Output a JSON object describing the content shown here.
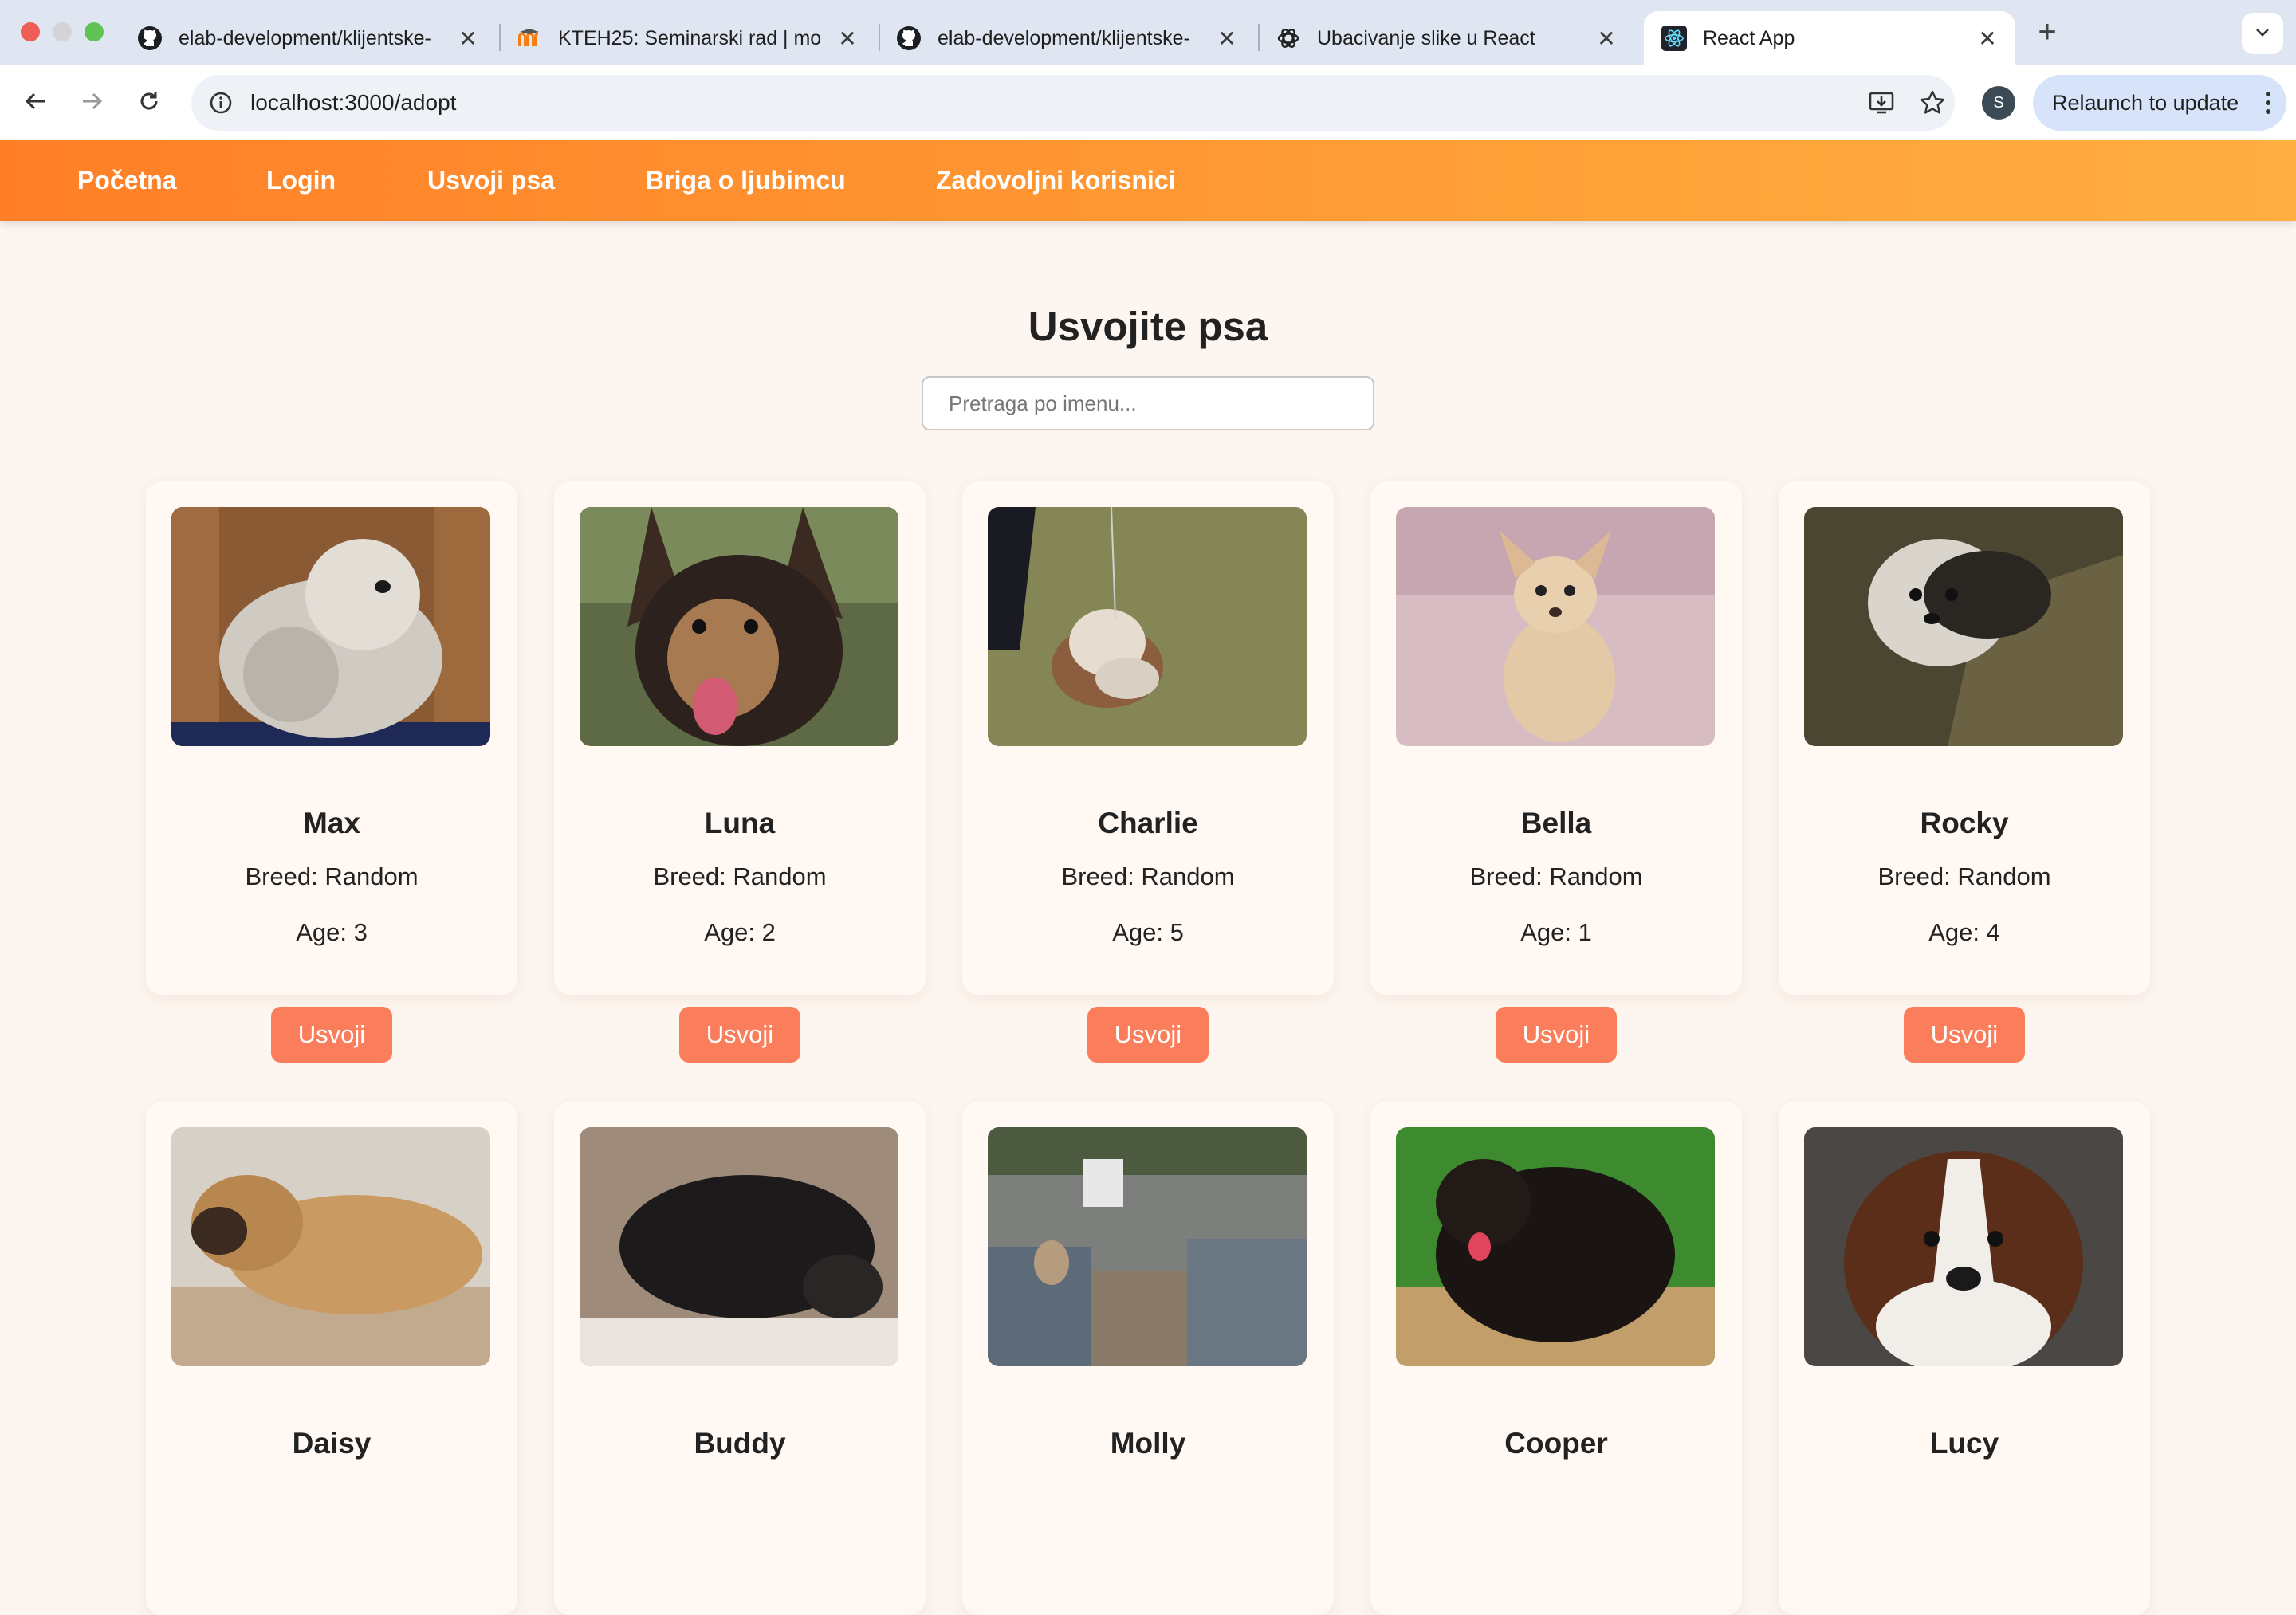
{
  "browser": {
    "tabs": [
      {
        "title": "elab-development/klijentske-",
        "icon": "github-icon",
        "active": false
      },
      {
        "title": "KTEH25: Seminarski rad | mo",
        "icon": "moodle-icon",
        "active": false
      },
      {
        "title": "elab-development/klijentske-",
        "icon": "github-icon",
        "active": false
      },
      {
        "title": "Ubacivanje slike u React",
        "icon": "chatgpt-icon",
        "active": false
      },
      {
        "title": "React App",
        "icon": "react-icon",
        "active": true
      }
    ],
    "url": "localhost:3000/adopt",
    "profile_initial": "S",
    "relaunch_label": "Relaunch to update"
  },
  "site_nav": {
    "items": [
      "Početna",
      "Login",
      "Usvoji psa",
      "Briga o ljubimcu",
      "Zadovoljni korisnici"
    ]
  },
  "main": {
    "title": "Usvojite psa",
    "search_placeholder": "Pretraga po imenu...",
    "dogs": [
      {
        "name": "Max",
        "breed": "Breed: Random",
        "age": "Age: 3",
        "button": "Usvoji"
      },
      {
        "name": "Luna",
        "breed": "Breed: Random",
        "age": "Age: 2",
        "button": "Usvoji"
      },
      {
        "name": "Charlie",
        "breed": "Breed: Random",
        "age": "Age: 5",
        "button": "Usvoji"
      },
      {
        "name": "Bella",
        "breed": "Breed: Random",
        "age": "Age: 1",
        "button": "Usvoji"
      },
      {
        "name": "Rocky",
        "breed": "Breed: Random",
        "age": "Age: 4",
        "button": "Usvoji"
      },
      {
        "name": "Daisy"
      },
      {
        "name": "Buddy"
      },
      {
        "name": "Molly"
      },
      {
        "name": "Cooper"
      },
      {
        "name": "Lucy"
      }
    ]
  },
  "colors": {
    "nav_gradient_start": "#ff7f27",
    "nav_gradient_end": "#ffae42",
    "button": "#fa7e5b",
    "page_background": "#fdf5ef"
  }
}
